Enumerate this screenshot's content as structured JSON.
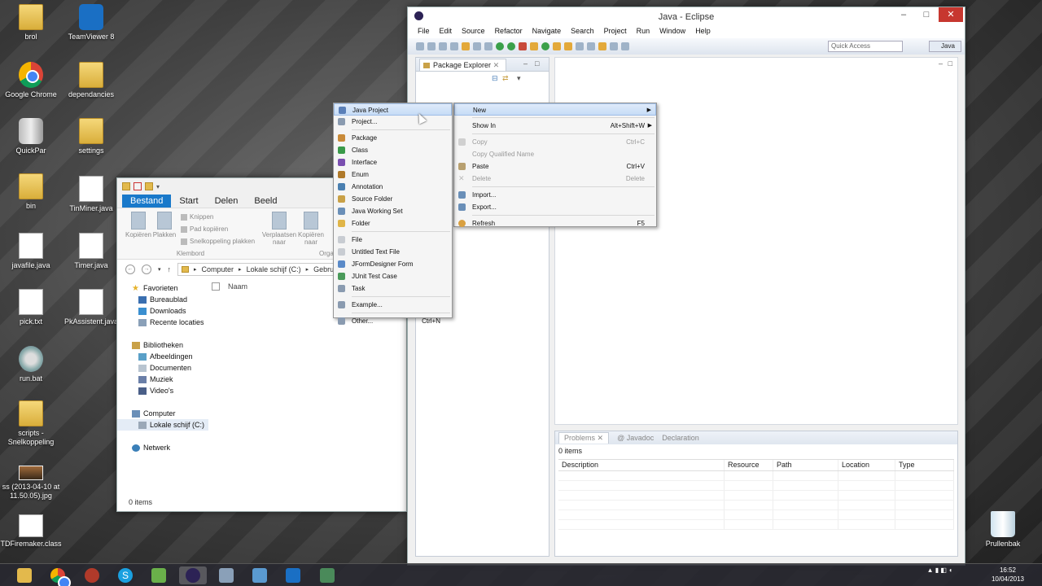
{
  "desktop": {
    "icons": [
      {
        "label": "brol",
        "kind": "folder"
      },
      {
        "label": "TeamViewer 8",
        "kind": "teamviewer"
      },
      {
        "label": "Google Chrome",
        "kind": "chrome"
      },
      {
        "label": "dependancies",
        "kind": "folder"
      },
      {
        "label": "QuickPar",
        "kind": "quickpar"
      },
      {
        "label": "settings",
        "kind": "folder"
      },
      {
        "label": "bin",
        "kind": "folder"
      },
      {
        "label": "TinMiner.java",
        "kind": "doc"
      },
      {
        "label": "javafile.java",
        "kind": "doc"
      },
      {
        "label": "Timer.java",
        "kind": "doc"
      },
      {
        "label": "pick.txt",
        "kind": "doc"
      },
      {
        "label": "PkAssistent.java",
        "kind": "doc"
      },
      {
        "label": "run.bat",
        "kind": "gear"
      },
      {
        "label": "scripts - Snelkoppeling",
        "kind": "folder"
      },
      {
        "label": "ss (2013-04-10 at 11.50.05).jpg",
        "kind": "image"
      },
      {
        "label": "TDFiremaker.class",
        "kind": "doc"
      },
      {
        "label": "Prullenbak",
        "kind": "recycle-bin"
      }
    ]
  },
  "explorer": {
    "ribbon_tabs": [
      "Bestand",
      "Start",
      "Delen",
      "Beeld"
    ],
    "ribbon": {
      "copy": "Kopiëren",
      "paste": "Plakken",
      "cut": "Knippen",
      "copy_path": "Pad kopiëren",
      "paste_shortcut": "Snelkoppeling plakken",
      "group_clipboard": "Klembord",
      "move_to": "Verplaatsen naar",
      "copy_to": "Kopiëren naar",
      "group_organize": "Organis"
    },
    "address": [
      "Computer",
      "Lokale schijf (C:)",
      "Gebruikers"
    ],
    "nav": {
      "favorites": "Favorieten",
      "desktop": "Bureaublad",
      "downloads": "Downloads",
      "recent": "Recente locaties",
      "libraries": "Bibliotheken",
      "pictures": "Afbeeldingen",
      "documents": "Documenten",
      "music": "Muziek",
      "videos": "Video's",
      "computer": "Computer",
      "local_disk": "Lokale schijf (C:)",
      "network": "Netwerk"
    },
    "column_name": "Naam",
    "status": "0 items"
  },
  "eclipse": {
    "title": "Java - Eclipse",
    "menu": [
      "File",
      "Edit",
      "Source",
      "Refactor",
      "Navigate",
      "Search",
      "Project",
      "Run",
      "Window",
      "Help"
    ],
    "quick_access_placeholder": "Quick Access",
    "perspective": "Java",
    "package_explorer_tab": "Package Explorer",
    "problems": {
      "tabs": [
        "Problems",
        "Javadoc",
        "Declaration"
      ],
      "count": "0 items",
      "columns": [
        "Description",
        "Resource",
        "Path",
        "Location",
        "Type"
      ]
    }
  },
  "context_menu": {
    "items": [
      {
        "label": "New",
        "shortcut": "",
        "state": "highlighted",
        "submenu": true
      },
      {
        "label": "Show In",
        "shortcut": "Alt+Shift+W",
        "state": "normal",
        "submenu": true
      },
      {
        "label": "Copy",
        "shortcut": "Ctrl+C",
        "state": "disabled"
      },
      {
        "label": "Copy Qualified Name",
        "shortcut": "",
        "state": "disabled"
      },
      {
        "label": "Paste",
        "shortcut": "Ctrl+V",
        "state": "normal"
      },
      {
        "label": "Delete",
        "shortcut": "Delete",
        "state": "disabled"
      },
      {
        "label": "Import...",
        "shortcut": "",
        "state": "normal"
      },
      {
        "label": "Export...",
        "shortcut": "",
        "state": "normal"
      },
      {
        "label": "Refresh",
        "shortcut": "F5",
        "state": "normal"
      }
    ]
  },
  "new_submenu": {
    "items": [
      {
        "label": "Java Project",
        "shortcut": "",
        "icon": "java-project",
        "color": "#5a7fb8"
      },
      {
        "label": "Project...",
        "shortcut": "",
        "icon": "project",
        "color": "#8a9bb0"
      },
      {
        "label": "Package",
        "shortcut": "",
        "icon": "package",
        "color": "#c98b3a"
      },
      {
        "label": "Class",
        "shortcut": "",
        "icon": "class",
        "color": "#3a9a4a"
      },
      {
        "label": "Interface",
        "shortcut": "",
        "icon": "interface",
        "color": "#7a4fb0"
      },
      {
        "label": "Enum",
        "shortcut": "",
        "icon": "enum",
        "color": "#b07a2a"
      },
      {
        "label": "Annotation",
        "shortcut": "",
        "icon": "annotation",
        "color": "#4a7fb0"
      },
      {
        "label": "Source Folder",
        "shortcut": "",
        "icon": "source-folder",
        "color": "#c9a147"
      },
      {
        "label": "Java Working Set",
        "shortcut": "",
        "icon": "working-set",
        "color": "#6a8fb8"
      },
      {
        "label": "Folder",
        "shortcut": "",
        "icon": "folder",
        "color": "#e0b548"
      },
      {
        "label": "File",
        "shortcut": "",
        "icon": "file",
        "color": "#c8ccd2"
      },
      {
        "label": "Untitled Text File",
        "shortcut": "",
        "icon": "text-file",
        "color": "#c8ccd2"
      },
      {
        "label": "JFormDesigner Form",
        "shortcut": "",
        "icon": "form",
        "color": "#5a8ac8"
      },
      {
        "label": "JUnit Test Case",
        "shortcut": "",
        "icon": "junit",
        "color": "#4a9a5a"
      },
      {
        "label": "Task",
        "shortcut": "",
        "icon": "task",
        "color": "#8a9bb0"
      },
      {
        "label": "Example...",
        "shortcut": "",
        "icon": "example",
        "color": "#8a9bb0"
      },
      {
        "label": "Other...",
        "shortcut": "Ctrl+N",
        "icon": "other",
        "color": "#8a9bb0"
      }
    ]
  },
  "taskbar": {
    "clock_time": "16:52",
    "clock_date": "10/04/2013"
  }
}
